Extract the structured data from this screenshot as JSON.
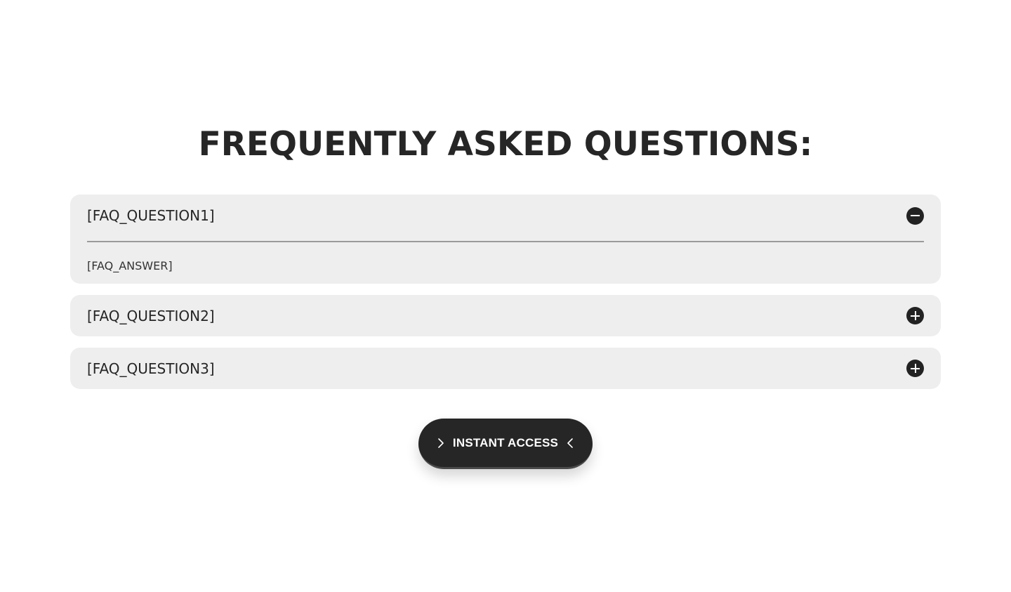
{
  "faq": {
    "title": "FREQUENTLY ASKED QUESTIONS:",
    "items": [
      {
        "question": "[FAQ_QUESTION1]",
        "answer": "[FAQ_ANSWER]",
        "expanded": true,
        "toggle_icon": "minus-circle-icon"
      },
      {
        "question": "[FAQ_QUESTION2]",
        "expanded": false,
        "toggle_icon": "plus-circle-icon"
      },
      {
        "question": "[FAQ_QUESTION3]",
        "expanded": false,
        "toggle_icon": "plus-circle-icon"
      }
    ]
  },
  "cta": {
    "label": "INSTANT ACCESS",
    "left_icon": "chevron-right-icon",
    "right_icon": "chevron-left-icon"
  },
  "colors": {
    "background": "#ffffff",
    "card_background": "#eeeeee",
    "dark": "#262626",
    "divider": "#9a9a9a"
  }
}
